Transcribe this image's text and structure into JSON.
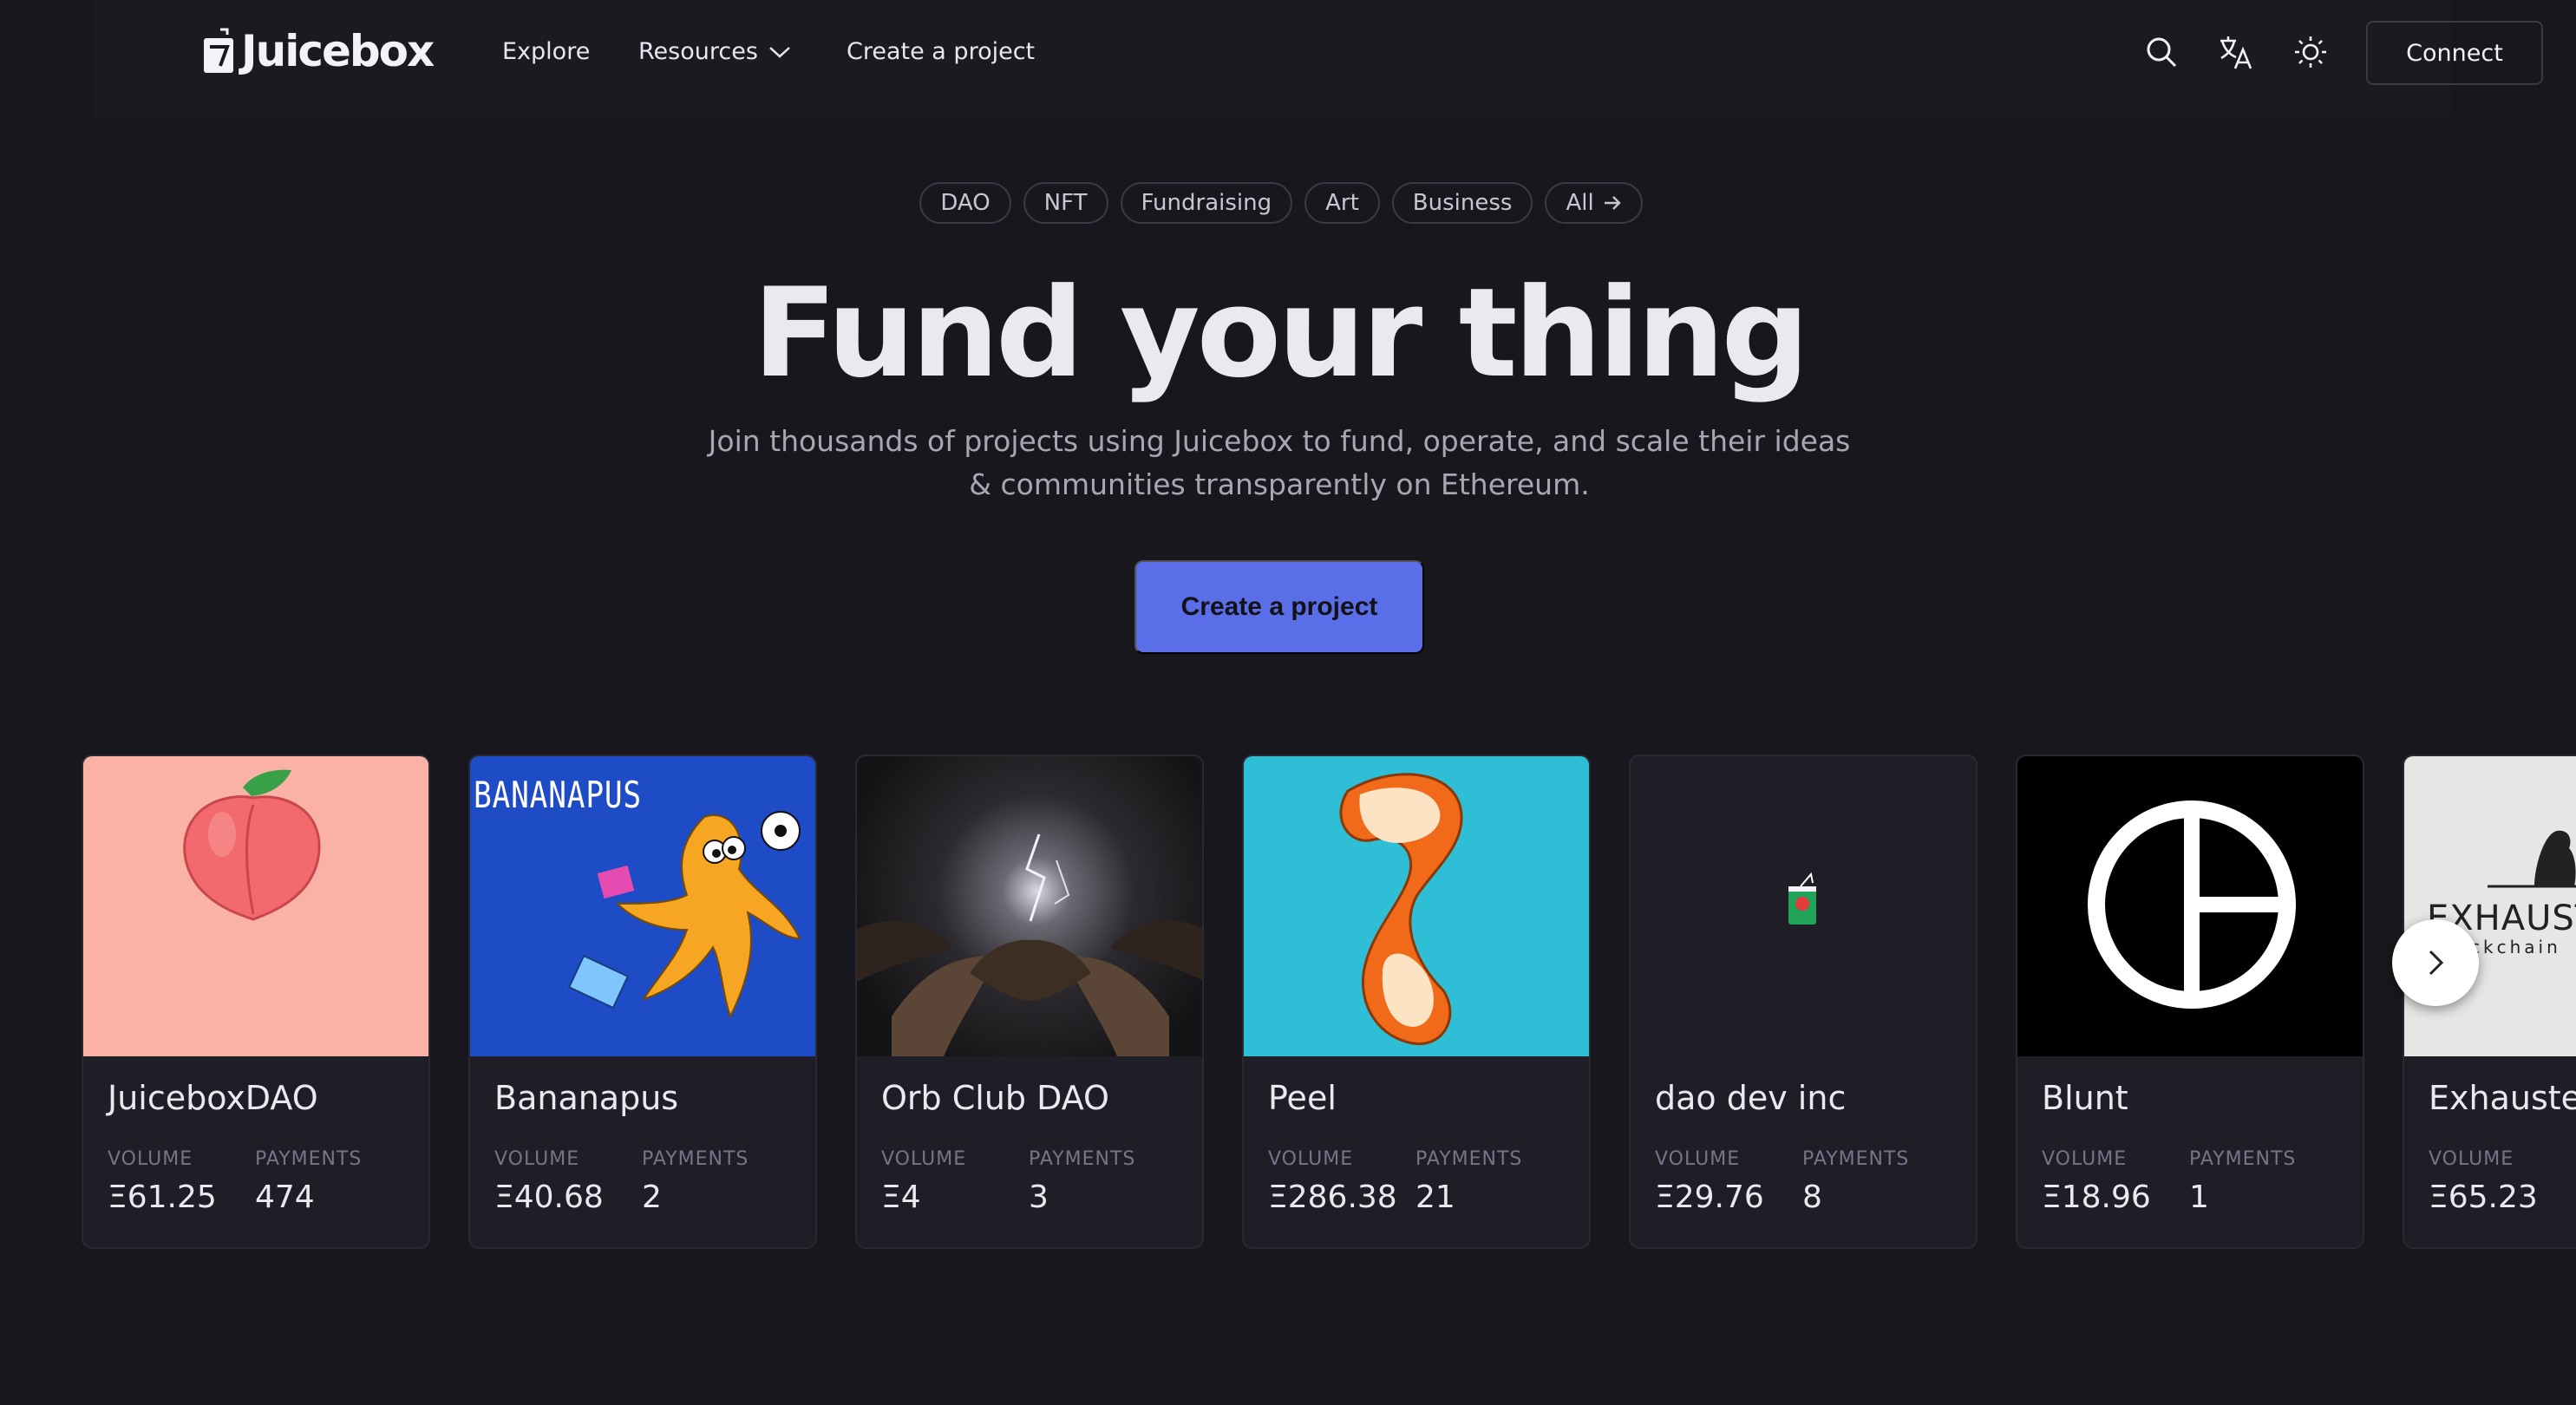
{
  "header": {
    "logo_text": "Juicebox",
    "nav": {
      "explore": "Explore",
      "resources": "Resources",
      "create": "Create a project"
    },
    "connect": "Connect"
  },
  "hero": {
    "chips": [
      "DAO",
      "NFT",
      "Fundraising",
      "Art",
      "Business",
      "All"
    ],
    "title": "Fund your thing",
    "subtitle_line1": "Join thousands of projects using Juicebox to fund, operate, and scale their ideas",
    "subtitle_line2": "& communities transparently on Ethereum.",
    "cta": "Create a project"
  },
  "projects": {
    "volume_label": "VOLUME",
    "payments_label": "PAYMENTS",
    "items": [
      {
        "name": "JuiceboxDAO",
        "volume": "Ξ61.25",
        "payments": "474"
      },
      {
        "name": "Bananapus",
        "volume": "Ξ40.68",
        "payments": "2",
        "image_text": "BANANAPUS"
      },
      {
        "name": "Orb Club DAO",
        "volume": "Ξ4",
        "payments": "3"
      },
      {
        "name": "Peel",
        "volume": "Ξ286.38",
        "payments": "21"
      },
      {
        "name": "dao dev inc",
        "volume": "Ξ29.76",
        "payments": "8"
      },
      {
        "name": "Blunt",
        "volume": "Ξ18.96",
        "payments": "1"
      },
      {
        "name": "Exhausted",
        "volume": "Ξ65.23",
        "payments": "",
        "image_text": "EXHAUSTE",
        "image_subtext": "ckchain"
      }
    ]
  },
  "colors": {
    "background": "#18171d",
    "accent": "#5a6ee8",
    "card": "#1f1e26"
  }
}
